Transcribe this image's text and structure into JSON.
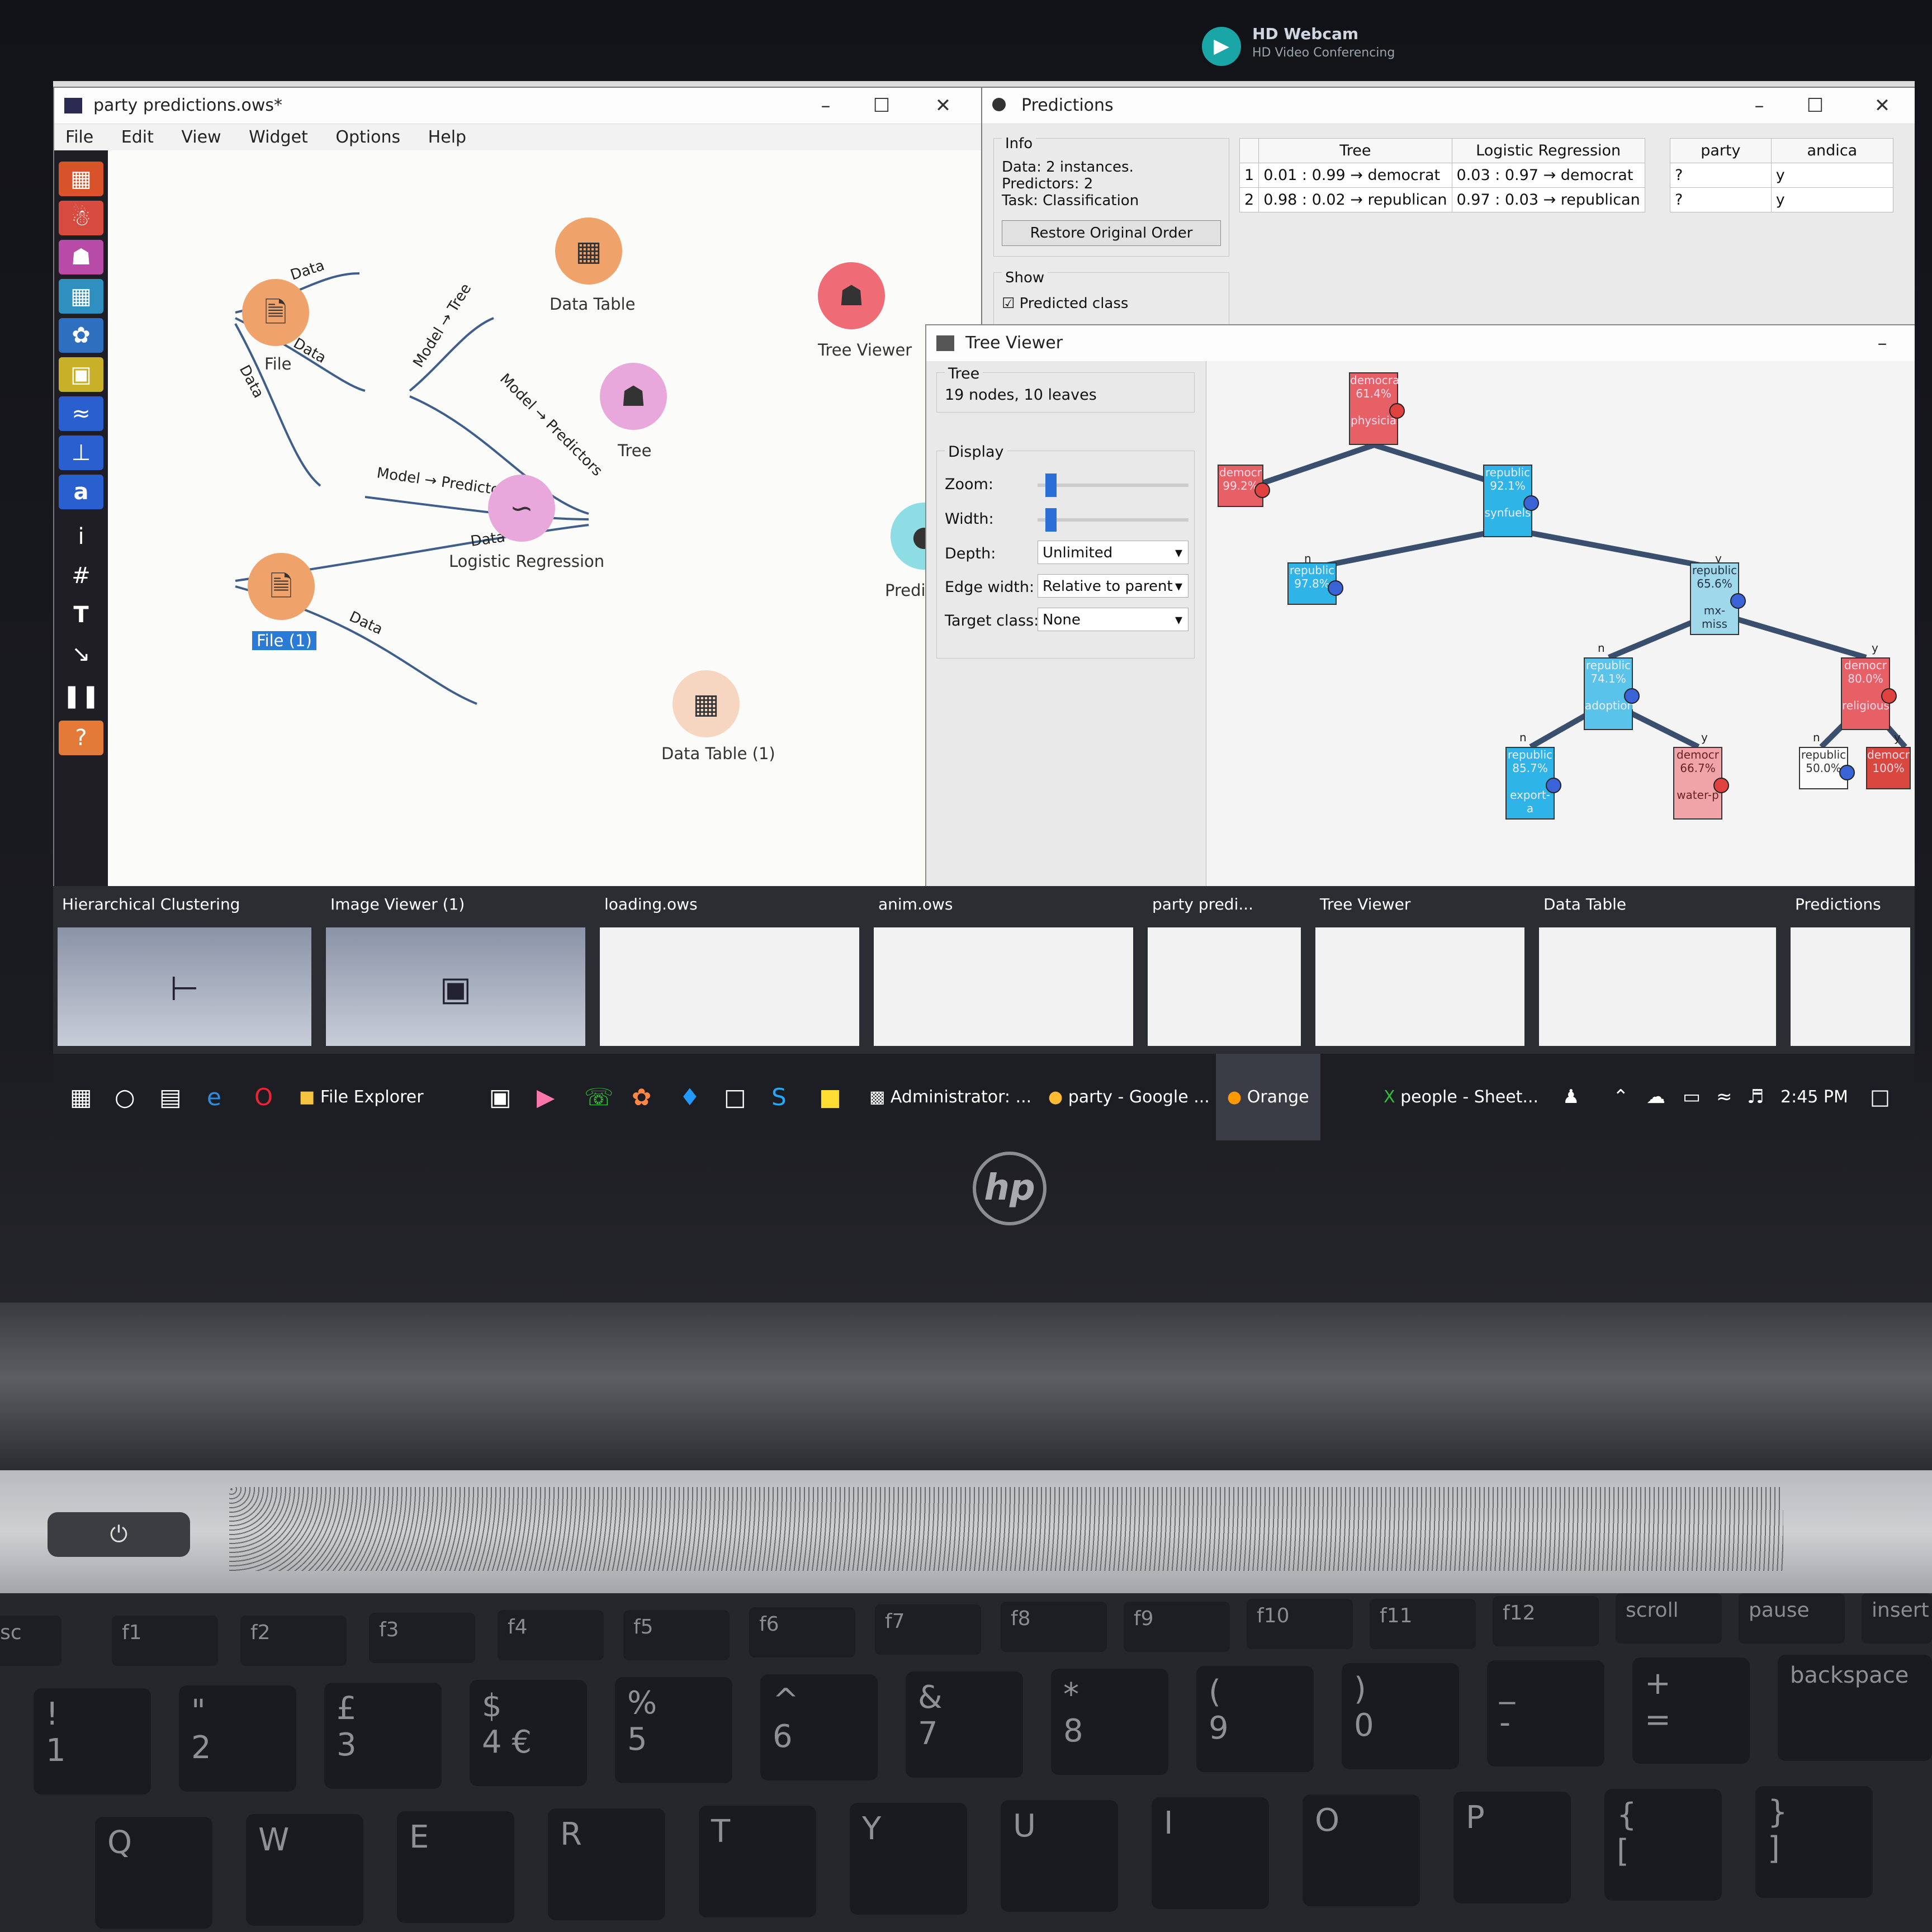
{
  "webcam": {
    "title": "HD Webcam",
    "subtitle": "HD Video Conferencing"
  },
  "orange": {
    "window_title": "party predictions.ows*",
    "menu": [
      "File",
      "Edit",
      "View",
      "Widget",
      "Options",
      "Help"
    ],
    "nodes": {
      "file": "File",
      "data_table": "Data Table",
      "tree": "Tree",
      "tree_viewer": "Tree Viewer",
      "logistic": "Logistic Regression",
      "predictions": "Predictions",
      "file1": "File (1)",
      "data_table1": "Data Table (1)"
    },
    "links": {
      "data": "Data",
      "model_tree": "Model → Tree",
      "model_predictors": "Model → Predictors"
    }
  },
  "predictions": {
    "title": "Predictions",
    "info_heading": "Info",
    "info_lines": [
      "Data: 2 instances.",
      "Predictors: 2",
      "Task: Classification"
    ],
    "restore_button": "Restore Original Order",
    "show_heading": "Show",
    "predicted_class": "Predicted class",
    "columns": [
      "Tree",
      "Logistic Regression"
    ],
    "rows": [
      {
        "n": "1",
        "tree": "0.01 : 0.99 → democrat",
        "lr": "0.03 : 0.97 → democrat"
      },
      {
        "n": "2",
        "tree": "0.98 : 0.02 → republican",
        "lr": "0.97 : 0.03 → republican"
      }
    ],
    "data_columns": [
      "party",
      "andica"
    ],
    "data_rows": [
      [
        "?",
        "y"
      ],
      [
        "?",
        "y"
      ]
    ]
  },
  "tree_viewer": {
    "title": "Tree Viewer",
    "tree_heading": "Tree",
    "tree_info": "19 nodes, 10 leaves",
    "display_heading": "Display",
    "zoom_label": "Zoom:",
    "width_label": "Width:",
    "depth_label": "Depth:",
    "edge_label": "Edge width:",
    "target_label": "Target class:",
    "depth_value": "Unlimited",
    "edge_value": "Relative to parent",
    "target_value": "None",
    "zoom_level": 0.05,
    "width_level": 0.05,
    "nodes": [
      {
        "cls": "democra",
        "pct": "61.4%",
        "attr": "physicia"
      },
      {
        "cls": "democr",
        "pct": "99.2%",
        "attr": ""
      },
      {
        "cls": "republic",
        "pct": "92.1%",
        "attr": "synfuels"
      },
      {
        "cls": "republic",
        "pct": "97.8%",
        "attr": ""
      },
      {
        "cls": "republic",
        "pct": "65.6%",
        "attr": "mx-miss"
      },
      {
        "cls": "republic",
        "pct": "74.1%",
        "attr": "adoption"
      },
      {
        "cls": "democr",
        "pct": "80.0%",
        "attr": "religious"
      },
      {
        "cls": "republic",
        "pct": "85.7%",
        "attr": "export-a"
      },
      {
        "cls": "democr",
        "pct": "66.7%",
        "attr": "water-p"
      },
      {
        "cls": "republic",
        "pct": "50.0%",
        "attr": ""
      },
      {
        "cls": "democr",
        "pct": "100%",
        "attr": ""
      }
    ],
    "edge_labels": {
      "n": "n",
      "y": "y"
    }
  },
  "previews": [
    "Hierarchical Clustering",
    "Image Viewer (1)",
    "loading.ows",
    "anim.ows",
    "party predi...",
    "Tree Viewer",
    "Data Table",
    "Predictions"
  ],
  "taskbar": {
    "file_explorer": "File Explorer",
    "admin": "Administrator: ...",
    "chrome": "party - Google ...",
    "orange": "Orange",
    "excel": "people - Sheet...",
    "clock": "2:45 PM"
  },
  "keyboard": {
    "fkeys": [
      "esc",
      "f1",
      "f2",
      "f3",
      "f4",
      "f5",
      "f6",
      "f7",
      "f8",
      "f9",
      "f10",
      "f11",
      "f12",
      "scroll",
      "pause",
      "insert"
    ],
    "numbers": [
      "!\n1",
      "\"\n2",
      "£\n3",
      "$\n4 €",
      "%\n5",
      "^\n6",
      "&\n7",
      "*\n8",
      "(\n9",
      ")\n0",
      "_\n-",
      "+\n=",
      "backspace"
    ],
    "letters": [
      "Q",
      "W",
      "E",
      "R",
      "T",
      "Y",
      "U",
      "I",
      "O",
      "P",
      "{\n[",
      "}\n]"
    ]
  },
  "colors": {
    "orange_node": "#f0a26b",
    "pink_node": "#e9a8dc",
    "red_node": "#ef6b75",
    "teal_node": "#8fdde4",
    "democrat": "#e66066",
    "republican": "#2fb4e8"
  }
}
